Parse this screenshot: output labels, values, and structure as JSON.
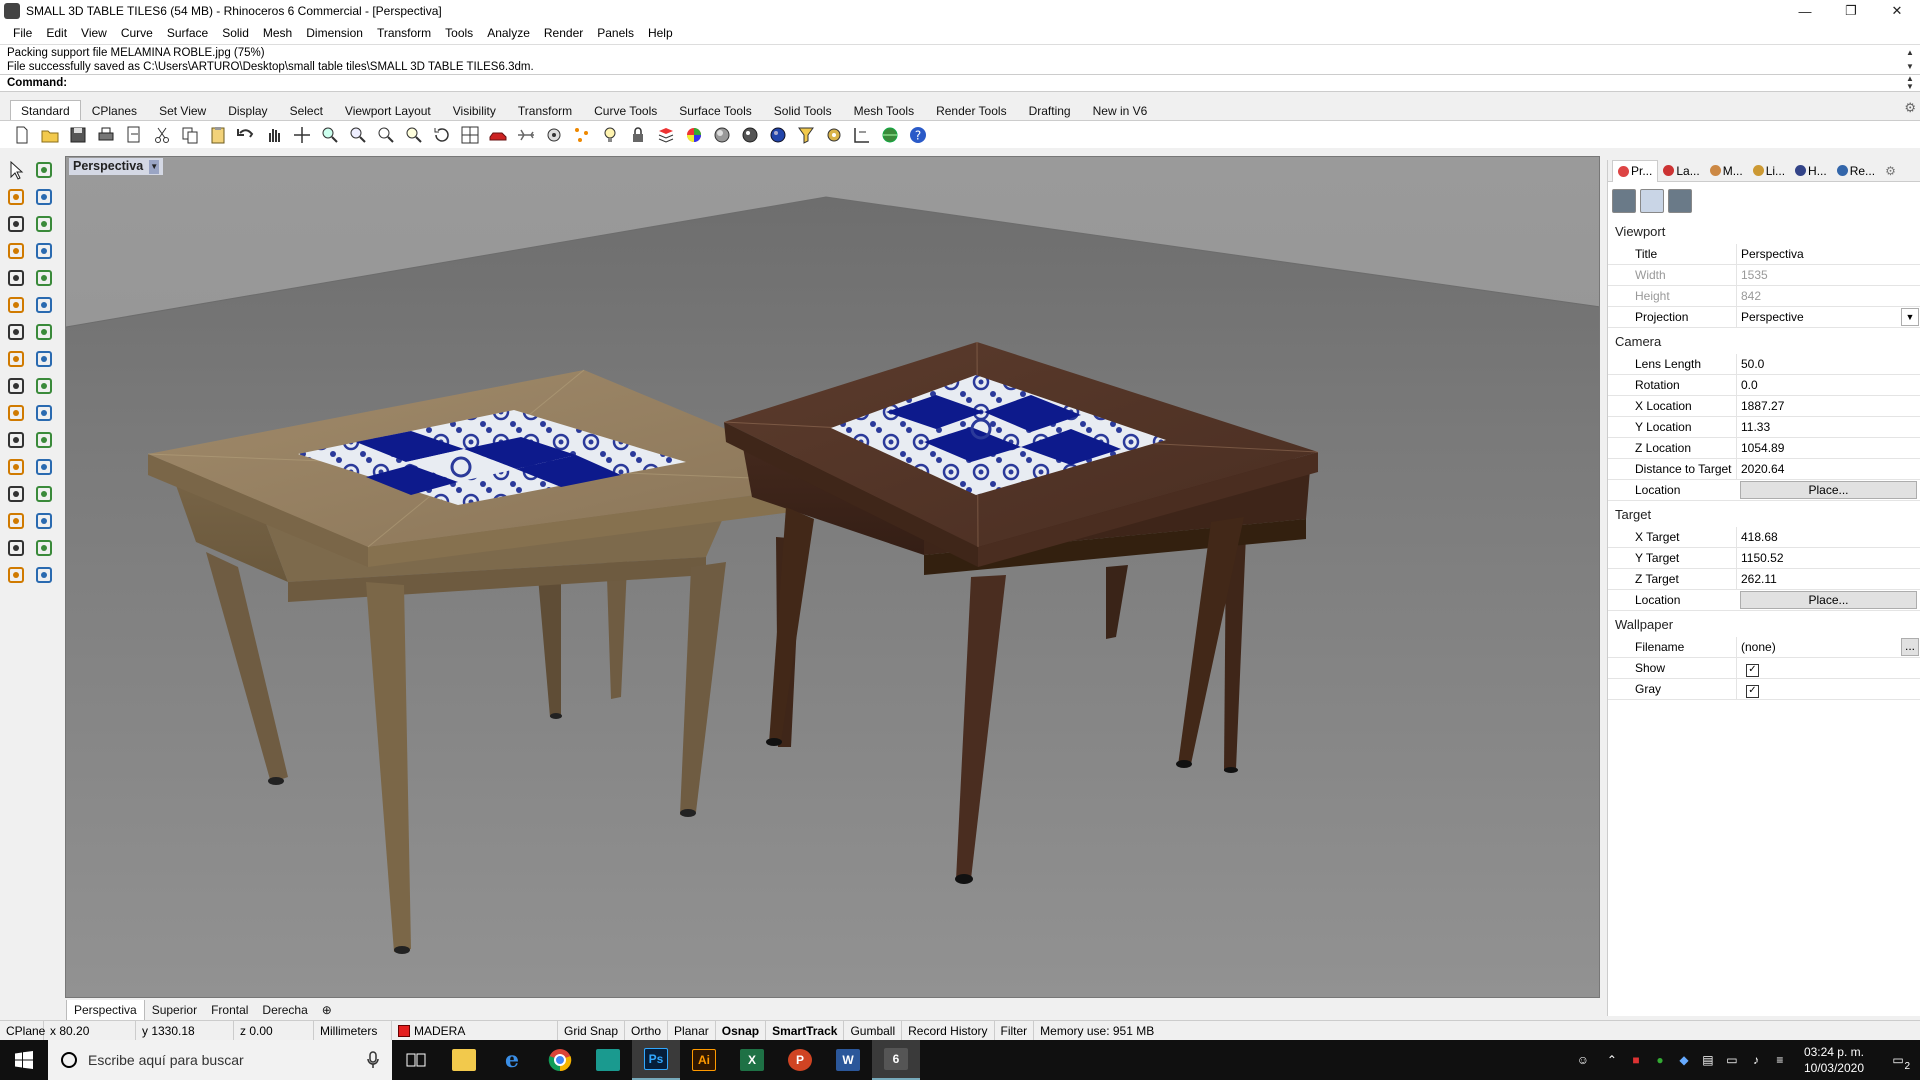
{
  "window": {
    "title": "SMALL 3D TABLE TILES6 (54 MB) - Rhinoceros 6 Commercial - [Perspectiva]",
    "minimize": "—",
    "maximize": "❐",
    "close": "✕"
  },
  "menu": [
    "File",
    "Edit",
    "View",
    "Curve",
    "Surface",
    "Solid",
    "Mesh",
    "Dimension",
    "Transform",
    "Tools",
    "Analyze",
    "Render",
    "Panels",
    "Help"
  ],
  "command": {
    "history_line1": "Packing support file MELAMINA ROBLE.jpg (75%)",
    "history_line2": "File successfully saved as C:\\Users\\ARTURO\\Desktop\\small table tiles\\SMALL 3D TABLE TILES6.3dm.",
    "prompt": "Command:"
  },
  "toolbar_tabs": [
    "Standard",
    "CPlanes",
    "Set View",
    "Display",
    "Select",
    "Viewport Layout",
    "Visibility",
    "Transform",
    "Curve Tools",
    "Surface Tools",
    "Solid Tools",
    "Mesh Tools",
    "Render Tools",
    "Drafting",
    "New in V6"
  ],
  "toolbar_icons": [
    "new-file",
    "open-file",
    "save",
    "print",
    "import",
    "cut",
    "copy",
    "paste",
    "undo",
    "pan",
    "move-view",
    "zoom-dynamic",
    "zoom-window",
    "zoom-extents",
    "zoom-selected",
    "rotate-view",
    "four-viewports",
    "car-render",
    "airplane",
    "options",
    "points",
    "light",
    "lock",
    "layer",
    "color-wheel",
    "shaded",
    "rendered",
    "material-ball",
    "filter",
    "settings-gears",
    "dimension",
    "globe",
    "help"
  ],
  "left_tools": [
    "select-arrow",
    "point",
    "polyline",
    "curve",
    "circle",
    "arc",
    "polygon",
    "rectangle",
    "ellipse",
    "fillet",
    "surface",
    "loft",
    "box",
    "boolean",
    "extrude",
    "offset",
    "gumball",
    "explode",
    "trim",
    "split",
    "mirror",
    "scale",
    "rotate",
    "move",
    "text",
    "hatch",
    "array",
    "dimension",
    "cplane",
    "check",
    "render",
    "light"
  ],
  "viewport": {
    "title": "Perspectiva",
    "tabs": [
      "Perspectiva",
      "Superior",
      "Frontal",
      "Derecha"
    ],
    "add_tab": "⊕"
  },
  "panel": {
    "tabs": [
      {
        "label": "Pr...",
        "color": "#d44"
      },
      {
        "label": "La...",
        "color": "#c33"
      },
      {
        "label": "M...",
        "color": "#c84"
      },
      {
        "label": "Li...",
        "color": "#c93"
      },
      {
        "label": "H...",
        "color": "#348"
      },
      {
        "label": "Re...",
        "color": "#36a"
      }
    ],
    "gear": "⚙",
    "viewport_header": "Viewport",
    "title_label": "Title",
    "title_value": "Perspectiva",
    "width_label": "Width",
    "width_value": "1535",
    "height_label": "Height",
    "height_value": "842",
    "projection_label": "Projection",
    "projection_value": "Perspective",
    "camera_header": "Camera",
    "lens_label": "Lens Length",
    "lens_value": "50.0",
    "rotation_label": "Rotation",
    "rotation_value": "0.0",
    "xloc_label": "X Location",
    "xloc_value": "1887.27",
    "yloc_label": "Y Location",
    "yloc_value": "11.33",
    "zloc_label": "Z Location",
    "zloc_value": "1054.89",
    "dist_label": "Distance to Target",
    "dist_value": "2020.64",
    "location_label": "Location",
    "place_label": "Place...",
    "target_header": "Target",
    "xtarget_label": "X Target",
    "xtarget_value": "418.68",
    "ytarget_label": "Y Target",
    "ytarget_value": "1150.52",
    "ztarget_label": "Z Target",
    "ztarget_value": "262.11",
    "target_location_label": "Location",
    "target_place_label": "Place...",
    "wallpaper_header": "Wallpaper",
    "filename_label": "Filename",
    "filename_value": "(none)",
    "dots": "...",
    "show_label": "Show",
    "show_checked": true,
    "gray_label": "Gray",
    "gray_checked": true,
    "check": "✓"
  },
  "status": {
    "cplane": "CPlane",
    "x": "x 80.20",
    "y": "y 1330.18",
    "z": "z 0.00",
    "units": "Millimeters",
    "layer": "MADERA",
    "layer_color": "#e41e1e",
    "grid_snap": "Grid Snap",
    "ortho": "Ortho",
    "planar": "Planar",
    "osnap": "Osnap",
    "smarttrack": "SmartTrack",
    "gumball": "Gumball",
    "record_history": "Record History",
    "filter": "Filter",
    "memory": "Memory use: 951 MB"
  },
  "taskbar": {
    "search_placeholder": "Escribe aquí para buscar",
    "apps": [
      {
        "name": "task-view",
        "label": ""
      },
      {
        "name": "file-explorer",
        "label": ""
      },
      {
        "name": "internet-explorer",
        "label": "e"
      },
      {
        "name": "chrome",
        "label": ""
      },
      {
        "name": "app-teal",
        "label": ""
      },
      {
        "name": "photoshop",
        "label": "Ps"
      },
      {
        "name": "illustrator",
        "label": "Ai"
      },
      {
        "name": "excel",
        "label": "X"
      },
      {
        "name": "powerpoint",
        "label": "P"
      },
      {
        "name": "word",
        "label": "W"
      },
      {
        "name": "rhino",
        "label": "6"
      }
    ],
    "time": "03:24 p. m.",
    "date": "10/03/2020",
    "notifications": "2"
  }
}
